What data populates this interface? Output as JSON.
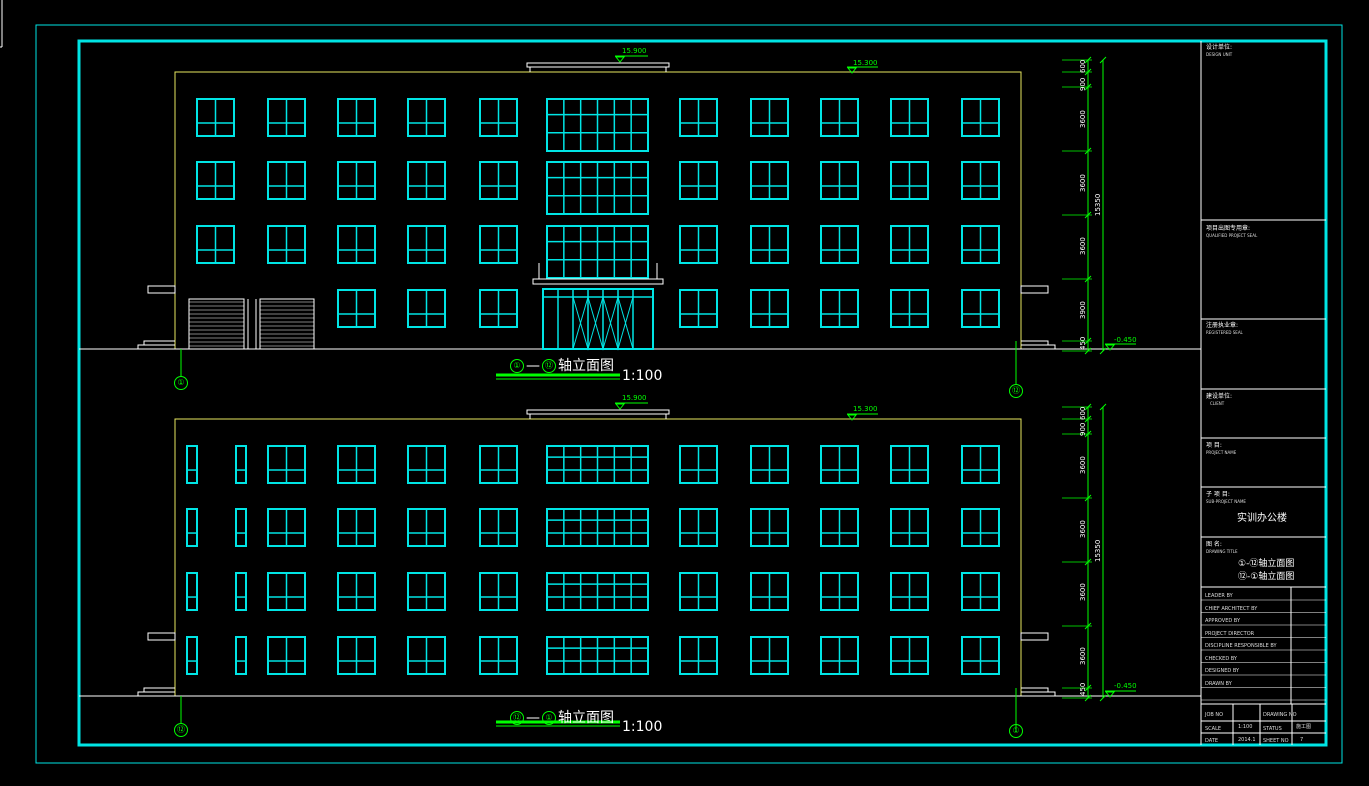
{
  "sheet": {
    "design_unit_label": "设计单位:",
    "design_unit_sub": "DESIGN UNIT",
    "project_seal_label": "项目出图专用章:",
    "project_seal_sub": "QUALIFIED PROJECT SEAL",
    "reg_seal_label": "注册执业章:",
    "reg_seal_sub": "REGISTERED SEAL",
    "client_label": "建设单位:",
    "client_sub": "CLIENT",
    "project_label": "项  目:",
    "project_sub": "PROJECT NAME",
    "subproject_label": "子 项 目:",
    "subproject_sub": "SUB-PROJECT NAME",
    "subproject_name": "实训办公楼",
    "drawing_title_label": "图  名:",
    "drawing_title_sub": "DRAWING TITLE",
    "drawing_title_1": "①-⑫轴立面图",
    "drawing_title_2": "⑫-①轴立面图",
    "signatures": [
      "LEADER BY",
      "CHIEF ARCHITECT BY",
      "APPROVED BY",
      "PROJECT DIRECTOR",
      "DISCIPLINE RESPONSIBLE BY",
      "CHECKED BY",
      "DESIGNED BY",
      "DRAWN BY"
    ],
    "info_row1": [
      "JOB NO",
      "",
      "DRAWING NO",
      ""
    ],
    "scale_label": "SCALE",
    "scale_value": "1:100",
    "status_label": "STATUS",
    "status_value": "施工图",
    "date_label": "DATE",
    "date_value": "2014.1",
    "sheet_label": "SHEET NO",
    "sheet_value": "7"
  },
  "views": [
    {
      "title_prefix": "①",
      "title_mid": "—",
      "title_suffix": "⑫",
      "title_text": "轴立面图",
      "scale": "1:100",
      "axis_left": "①",
      "axis_right": "⑫",
      "elev_top": "15.900",
      "elev_roof": "15.300",
      "elev_ground": "-0.450",
      "dims": [
        "900",
        "600",
        "3600",
        "3600",
        "3600",
        "3900",
        "450"
      ],
      "total": "15350"
    },
    {
      "title_prefix": "⑫",
      "title_mid": "—",
      "title_suffix": "①",
      "title_text": "轴立面图",
      "scale": "1:100",
      "axis_left": "⑫",
      "axis_right": "①",
      "elev_top": "15.900",
      "elev_roof": "15.300",
      "elev_ground": "-0.450",
      "dims": [
        "900",
        "600",
        "3600",
        "3600",
        "3600",
        "3600",
        "450"
      ],
      "total": "15350"
    }
  ],
  "colors": {
    "background": "#000000",
    "frame": "#00e5e5",
    "windows": "#00e5e5",
    "outline": "#e8e860",
    "dimension": "#00ff00",
    "text": "#ffffff"
  }
}
